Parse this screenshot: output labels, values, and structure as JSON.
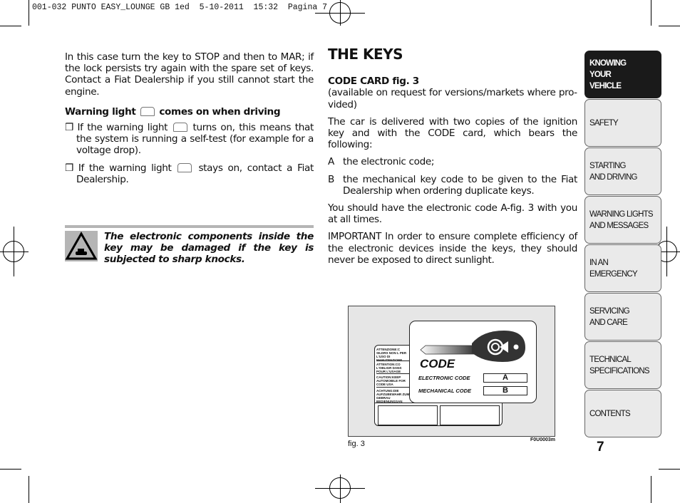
{
  "header": "001-032 PUNTO EASY_LOUNGE GB 1ed  5-10-2011  15:32  Pagina 7",
  "left": {
    "intro": "In this case turn the key to STOP and then to MAR; if the lock persists try again with the spare set of keys. Contact a Fiat Dealership if you still cannot start the engine.",
    "warning_heading_a": "Warning light",
    "warning_heading_b": "comes on when driving",
    "bullet_glyph": "❒",
    "bullet1_a": "If the warning light",
    "bullet1_b": "turns on, this means that the system is running a self-test (for example for a voltage drop).",
    "bullet2_a": "If the warning light",
    "bullet2_b": "stays on, contact a Fiat Dealer­ship.",
    "warning_icon": "car-warning-triangle-icon",
    "note": "The electronic components inside the key may be damaged if the key is subjected to sharp knocks."
  },
  "right": {
    "title": "THE KEYS",
    "code_card_heading": "CODE CARD fig. 3",
    "code_card_note": "(available on request for versions/markets where pro­vided)",
    "para1": "The car is delivered with two copies of the ignition key and with the CODE card, which bears the following:",
    "items": [
      {
        "letter": "A",
        "text": "the electronic code;"
      },
      {
        "letter": "B",
        "text": "the mechanical key code to be given to the Fiat Deal­ership when ordering duplicate keys."
      }
    ],
    "para2": "You should have the electronic code A-fig. 3 with you at all times.",
    "para3": "IMPORTANT In order to ensure complete efficiency of the electronic devices inside the keys, they should never be exposed to direct sunlight."
  },
  "figure": {
    "card_title": "CODE",
    "electronic_label": "ELECTRONIC CODE",
    "electronic_value": "A",
    "mechanical_label": "MECHANICAL CODE",
    "mechanical_value": "B",
    "back_texts": [
      "ATTENZIONE:C SILDRS NON L PER L'USO DI MANUTENZIONE",
      "ATTENTION:CO L'OBLIGR DANS POUR L'USAGE",
      "CAUTION:KEEP AUTOMOBILE FOR CODE USA",
      "ACHTUNG:DIE AUFZUBEWAHR ZUM GEBRAU BEDIENUNGSAN"
    ],
    "caption": "fig. 3",
    "code": "F0U0003m"
  },
  "sidebar": {
    "tabs": [
      {
        "label": "KNOWING\nYOUR\nVEHICLE",
        "active": true
      },
      {
        "label": "SAFETY"
      },
      {
        "label": "STARTING\nAND DRIVING"
      },
      {
        "label": "WARNING LIGHTS\nAND MESSAGES"
      },
      {
        "label": "IN AN\nEMERGENCY"
      },
      {
        "label": "SERVICING\nAND CARE"
      },
      {
        "label": "TECHNICAL\nSPECIFICATIONS"
      },
      {
        "label": "CONTENTS"
      }
    ]
  },
  "page_number": "7"
}
